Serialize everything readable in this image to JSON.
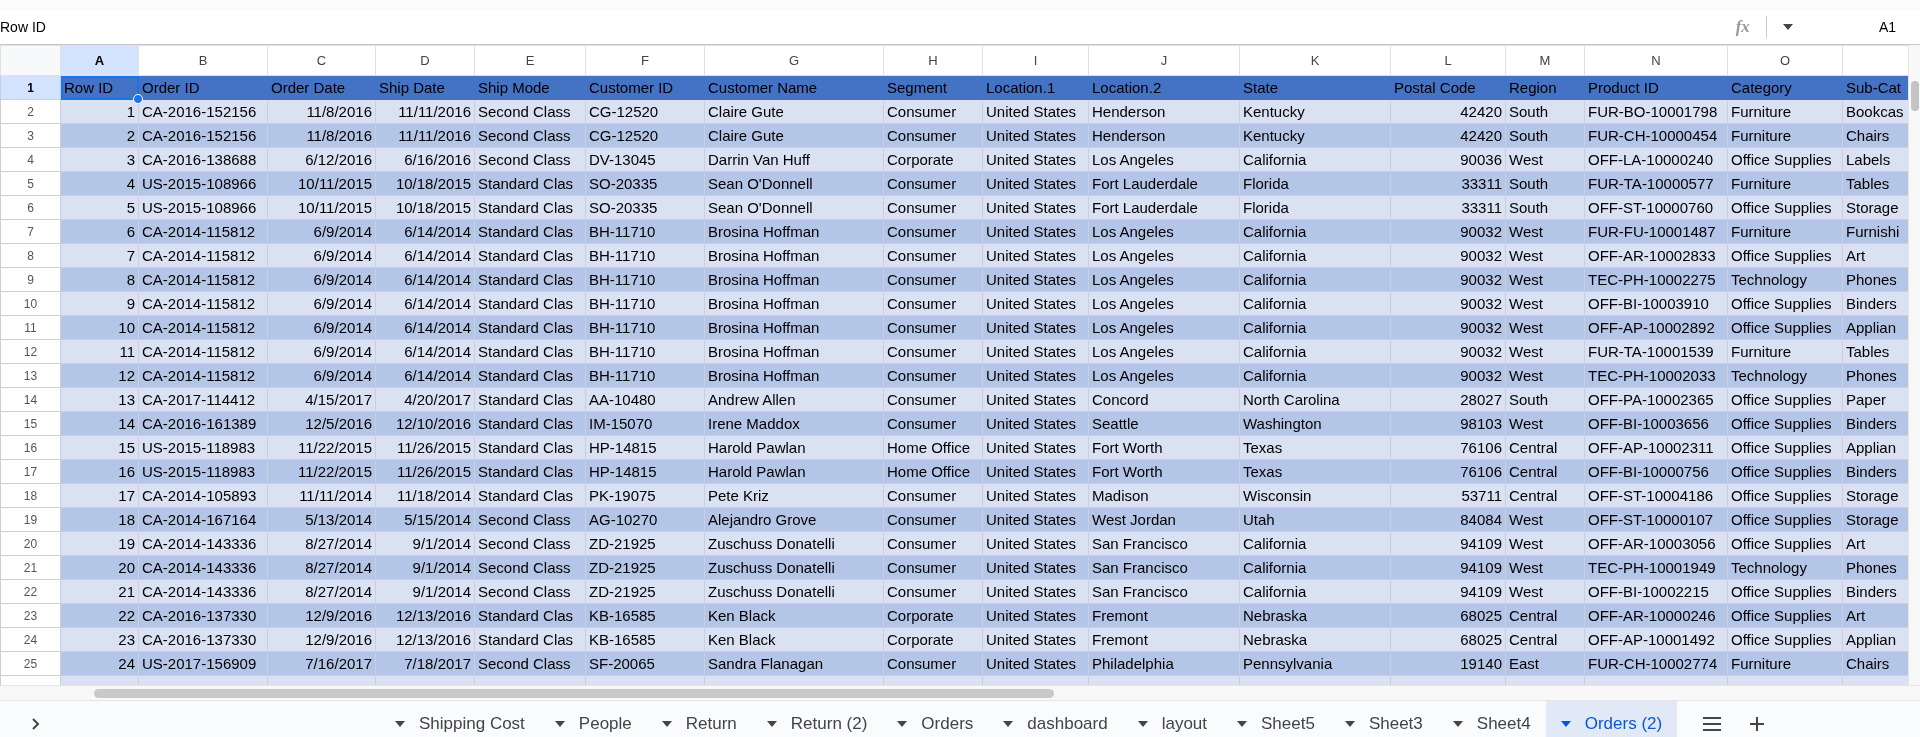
{
  "formula_bar": {
    "content": "Row ID",
    "fx_label": "fx",
    "name_box": "A1"
  },
  "sheet": {
    "columns": [
      {
        "letter": "A",
        "selected": true,
        "right_aligned": true
      },
      {
        "letter": "B",
        "selected": false,
        "right_aligned": false
      },
      {
        "letter": "C",
        "selected": false,
        "right_aligned": true
      },
      {
        "letter": "D",
        "selected": false,
        "right_aligned": true
      },
      {
        "letter": "E",
        "selected": false,
        "right_aligned": false
      },
      {
        "letter": "F",
        "selected": false,
        "right_aligned": false
      },
      {
        "letter": "G",
        "selected": false,
        "right_aligned": false
      },
      {
        "letter": "H",
        "selected": false,
        "right_aligned": false
      },
      {
        "letter": "I",
        "selected": false,
        "right_aligned": false
      },
      {
        "letter": "J",
        "selected": false,
        "right_aligned": false
      },
      {
        "letter": "K",
        "selected": false,
        "right_aligned": false
      },
      {
        "letter": "L",
        "selected": false,
        "right_aligned": true
      },
      {
        "letter": "M",
        "selected": false,
        "right_aligned": false
      },
      {
        "letter": "N",
        "selected": false,
        "right_aligned": false
      },
      {
        "letter": "O",
        "selected": false,
        "right_aligned": false
      }
    ],
    "rows": [
      {
        "number": "1",
        "selected": true,
        "kind": "header",
        "cells": [
          "Row ID",
          "Order ID",
          "Order Date",
          "Ship Date",
          "Ship Mode",
          "Customer ID",
          "Customer Name",
          "Segment",
          "Location.1",
          "Location.2",
          "State",
          "Postal Code",
          "Region",
          "Product ID",
          "Category",
          "Sub-Cat"
        ]
      },
      {
        "number": "2",
        "selected": false,
        "kind": "data",
        "cells": [
          "1",
          "CA-2016-152156",
          "11/8/2016",
          "11/11/2016",
          "Second Class",
          "CG-12520",
          "Claire Gute",
          "Consumer",
          "United States",
          "Henderson",
          "Kentucky",
          "42420",
          "South",
          "FUR-BO-10001798",
          "Furniture",
          "Bookcas"
        ]
      },
      {
        "number": "3",
        "selected": false,
        "kind": "data",
        "cells": [
          "2",
          "CA-2016-152156",
          "11/8/2016",
          "11/11/2016",
          "Second Class",
          "CG-12520",
          "Claire Gute",
          "Consumer",
          "United States",
          "Henderson",
          "Kentucky",
          "42420",
          "South",
          "FUR-CH-10000454",
          "Furniture",
          "Chairs"
        ]
      },
      {
        "number": "4",
        "selected": false,
        "kind": "data",
        "cells": [
          "3",
          "CA-2016-138688",
          "6/12/2016",
          "6/16/2016",
          "Second Class",
          "DV-13045",
          "Darrin Van Huff",
          "Corporate",
          "United States",
          "Los Angeles",
          "California",
          "90036",
          "West",
          "OFF-LA-10000240",
          "Office Supplies",
          "Labels"
        ]
      },
      {
        "number": "5",
        "selected": false,
        "kind": "data",
        "cells": [
          "4",
          "US-2015-108966",
          "10/11/2015",
          "10/18/2015",
          "Standard Clas",
          "SO-20335",
          "Sean O'Donnell",
          "Consumer",
          "United States",
          "Fort Lauderdale",
          "Florida",
          "33311",
          "South",
          "FUR-TA-10000577",
          "Furniture",
          "Tables"
        ]
      },
      {
        "number": "6",
        "selected": false,
        "kind": "data",
        "cells": [
          "5",
          "US-2015-108966",
          "10/11/2015",
          "10/18/2015",
          "Standard Clas",
          "SO-20335",
          "Sean O'Donnell",
          "Consumer",
          "United States",
          "Fort Lauderdale",
          "Florida",
          "33311",
          "South",
          "OFF-ST-10000760",
          "Office Supplies",
          "Storage"
        ]
      },
      {
        "number": "7",
        "selected": false,
        "kind": "data",
        "cells": [
          "6",
          "CA-2014-115812",
          "6/9/2014",
          "6/14/2014",
          "Standard Clas",
          "BH-11710",
          "Brosina Hoffman",
          "Consumer",
          "United States",
          "Los Angeles",
          "California",
          "90032",
          "West",
          "FUR-FU-10001487",
          "Furniture",
          "Furnishi"
        ]
      },
      {
        "number": "8",
        "selected": false,
        "kind": "data",
        "cells": [
          "7",
          "CA-2014-115812",
          "6/9/2014",
          "6/14/2014",
          "Standard Clas",
          "BH-11710",
          "Brosina Hoffman",
          "Consumer",
          "United States",
          "Los Angeles",
          "California",
          "90032",
          "West",
          "OFF-AR-10002833",
          "Office Supplies",
          "Art"
        ]
      },
      {
        "number": "9",
        "selected": false,
        "kind": "data",
        "cells": [
          "8",
          "CA-2014-115812",
          "6/9/2014",
          "6/14/2014",
          "Standard Clas",
          "BH-11710",
          "Brosina Hoffman",
          "Consumer",
          "United States",
          "Los Angeles",
          "California",
          "90032",
          "West",
          "TEC-PH-10002275",
          "Technology",
          "Phones"
        ]
      },
      {
        "number": "10",
        "selected": false,
        "kind": "data",
        "cells": [
          "9",
          "CA-2014-115812",
          "6/9/2014",
          "6/14/2014",
          "Standard Clas",
          "BH-11710",
          "Brosina Hoffman",
          "Consumer",
          "United States",
          "Los Angeles",
          "California",
          "90032",
          "West",
          "OFF-BI-10003910",
          "Office Supplies",
          "Binders"
        ]
      },
      {
        "number": "11",
        "selected": false,
        "kind": "data",
        "cells": [
          "10",
          "CA-2014-115812",
          "6/9/2014",
          "6/14/2014",
          "Standard Clas",
          "BH-11710",
          "Brosina Hoffman",
          "Consumer",
          "United States",
          "Los Angeles",
          "California",
          "90032",
          "West",
          "OFF-AP-10002892",
          "Office Supplies",
          "Applian"
        ]
      },
      {
        "number": "12",
        "selected": false,
        "kind": "data",
        "cells": [
          "11",
          "CA-2014-115812",
          "6/9/2014",
          "6/14/2014",
          "Standard Clas",
          "BH-11710",
          "Brosina Hoffman",
          "Consumer",
          "United States",
          "Los Angeles",
          "California",
          "90032",
          "West",
          "FUR-TA-10001539",
          "Furniture",
          "Tables"
        ]
      },
      {
        "number": "13",
        "selected": false,
        "kind": "data",
        "cells": [
          "12",
          "CA-2014-115812",
          "6/9/2014",
          "6/14/2014",
          "Standard Clas",
          "BH-11710",
          "Brosina Hoffman",
          "Consumer",
          "United States",
          "Los Angeles",
          "California",
          "90032",
          "West",
          "TEC-PH-10002033",
          "Technology",
          "Phones"
        ]
      },
      {
        "number": "14",
        "selected": false,
        "kind": "data",
        "cells": [
          "13",
          "CA-2017-114412",
          "4/15/2017",
          "4/20/2017",
          "Standard Clas",
          "AA-10480",
          "Andrew Allen",
          "Consumer",
          "United States",
          "Concord",
          "North Carolina",
          "28027",
          "South",
          "OFF-PA-10002365",
          "Office Supplies",
          "Paper"
        ]
      },
      {
        "number": "15",
        "selected": false,
        "kind": "data",
        "cells": [
          "14",
          "CA-2016-161389",
          "12/5/2016",
          "12/10/2016",
          "Standard Clas",
          "IM-15070",
          "Irene Maddox",
          "Consumer",
          "United States",
          "Seattle",
          "Washington",
          "98103",
          "West",
          "OFF-BI-10003656",
          "Office Supplies",
          "Binders"
        ]
      },
      {
        "number": "16",
        "selected": false,
        "kind": "data",
        "cells": [
          "15",
          "US-2015-118983",
          "11/22/2015",
          "11/26/2015",
          "Standard Clas",
          "HP-14815",
          "Harold Pawlan",
          "Home Office",
          "United States",
          "Fort Worth",
          "Texas",
          "76106",
          "Central",
          "OFF-AP-10002311",
          "Office Supplies",
          "Applian"
        ]
      },
      {
        "number": "17",
        "selected": false,
        "kind": "data",
        "cells": [
          "16",
          "US-2015-118983",
          "11/22/2015",
          "11/26/2015",
          "Standard Clas",
          "HP-14815",
          "Harold Pawlan",
          "Home Office",
          "United States",
          "Fort Worth",
          "Texas",
          "76106",
          "Central",
          "OFF-BI-10000756",
          "Office Supplies",
          "Binders"
        ]
      },
      {
        "number": "18",
        "selected": false,
        "kind": "data",
        "cells": [
          "17",
          "CA-2014-105893",
          "11/11/2014",
          "11/18/2014",
          "Standard Clas",
          "PK-19075",
          "Pete Kriz",
          "Consumer",
          "United States",
          "Madison",
          "Wisconsin",
          "53711",
          "Central",
          "OFF-ST-10004186",
          "Office Supplies",
          "Storage"
        ]
      },
      {
        "number": "19",
        "selected": false,
        "kind": "data",
        "cells": [
          "18",
          "CA-2014-167164",
          "5/13/2014",
          "5/15/2014",
          "Second Class",
          "AG-10270",
          "Alejandro Grove",
          "Consumer",
          "United States",
          "West Jordan",
          "Utah",
          "84084",
          "West",
          "OFF-ST-10000107",
          "Office Supplies",
          "Storage"
        ]
      },
      {
        "number": "20",
        "selected": false,
        "kind": "data",
        "cells": [
          "19",
          "CA-2014-143336",
          "8/27/2014",
          "9/1/2014",
          "Second Class",
          "ZD-21925",
          "Zuschuss Donatelli",
          "Consumer",
          "United States",
          "San Francisco",
          "California",
          "94109",
          "West",
          "OFF-AR-10003056",
          "Office Supplies",
          "Art"
        ]
      },
      {
        "number": "21",
        "selected": false,
        "kind": "data",
        "cells": [
          "20",
          "CA-2014-143336",
          "8/27/2014",
          "9/1/2014",
          "Second Class",
          "ZD-21925",
          "Zuschuss Donatelli",
          "Consumer",
          "United States",
          "San Francisco",
          "California",
          "94109",
          "West",
          "TEC-PH-10001949",
          "Technology",
          "Phones"
        ]
      },
      {
        "number": "22",
        "selected": false,
        "kind": "data",
        "cells": [
          "21",
          "CA-2014-143336",
          "8/27/2014",
          "9/1/2014",
          "Second Class",
          "ZD-21925",
          "Zuschuss Donatelli",
          "Consumer",
          "United States",
          "San Francisco",
          "California",
          "94109",
          "West",
          "OFF-BI-10002215",
          "Office Supplies",
          "Binders"
        ]
      },
      {
        "number": "23",
        "selected": false,
        "kind": "data",
        "cells": [
          "22",
          "CA-2016-137330",
          "12/9/2016",
          "12/13/2016",
          "Standard Clas",
          "KB-16585",
          "Ken Black",
          "Corporate",
          "United States",
          "Fremont",
          "Nebraska",
          "68025",
          "Central",
          "OFF-AR-10000246",
          "Office Supplies",
          "Art"
        ]
      },
      {
        "number": "24",
        "selected": false,
        "kind": "data",
        "cells": [
          "23",
          "CA-2016-137330",
          "12/9/2016",
          "12/13/2016",
          "Standard Clas",
          "KB-16585",
          "Ken Black",
          "Corporate",
          "United States",
          "Fremont",
          "Nebraska",
          "68025",
          "Central",
          "OFF-AP-10001492",
          "Office Supplies",
          "Applian"
        ]
      },
      {
        "number": "25",
        "selected": false,
        "kind": "data",
        "cells": [
          "24",
          "US-2017-156909",
          "7/16/2017",
          "7/18/2017",
          "Second Class",
          "SF-20065",
          "Sandra Flanagan",
          "Consumer",
          "United States",
          "Philadelphia",
          "Pennsylvania",
          "19140",
          "East",
          "FUR-CH-10002774",
          "Furniture",
          "Chairs"
        ]
      }
    ]
  },
  "sheet_tabs": [
    {
      "label": "Shipping Cost",
      "selected": false
    },
    {
      "label": "People",
      "selected": false
    },
    {
      "label": "Return",
      "selected": false
    },
    {
      "label": "Return (2)",
      "selected": false
    },
    {
      "label": "Orders",
      "selected": false
    },
    {
      "label": "dashboard",
      "selected": false
    },
    {
      "label": "layout",
      "selected": false
    },
    {
      "label": "Sheet5",
      "selected": false
    },
    {
      "label": "Sheet3",
      "selected": false
    },
    {
      "label": "Sheet4",
      "selected": false
    },
    {
      "label": "Orders (2)",
      "selected": true
    }
  ]
}
